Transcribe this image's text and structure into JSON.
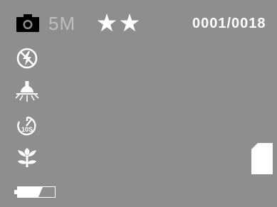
{
  "status_bar": {
    "mode_icon": "camera-icon",
    "resolution": "5M",
    "quality_stars": 2,
    "quality_icon": "star-icon",
    "shot_counter": "0001/0018"
  },
  "settings_column": [
    {
      "icon": "flash-off-icon",
      "label": "Flash off"
    },
    {
      "icon": "white-balance-sunny-icon",
      "label": "White balance daylight"
    },
    {
      "icon": "self-timer-icon",
      "label": "Self-timer",
      "timer_text": "10S"
    },
    {
      "icon": "macro-flower-icon",
      "label": "Macro"
    }
  ],
  "battery": {
    "icon": "battery-icon",
    "level": 0.75
  },
  "storage": {
    "icon": "sd-card-icon"
  },
  "colors": {
    "screen_background": "#8e8e8e",
    "icon_white": "#ffffff",
    "resolution_text": "#bdbdbd",
    "icon_black": "#000000"
  }
}
